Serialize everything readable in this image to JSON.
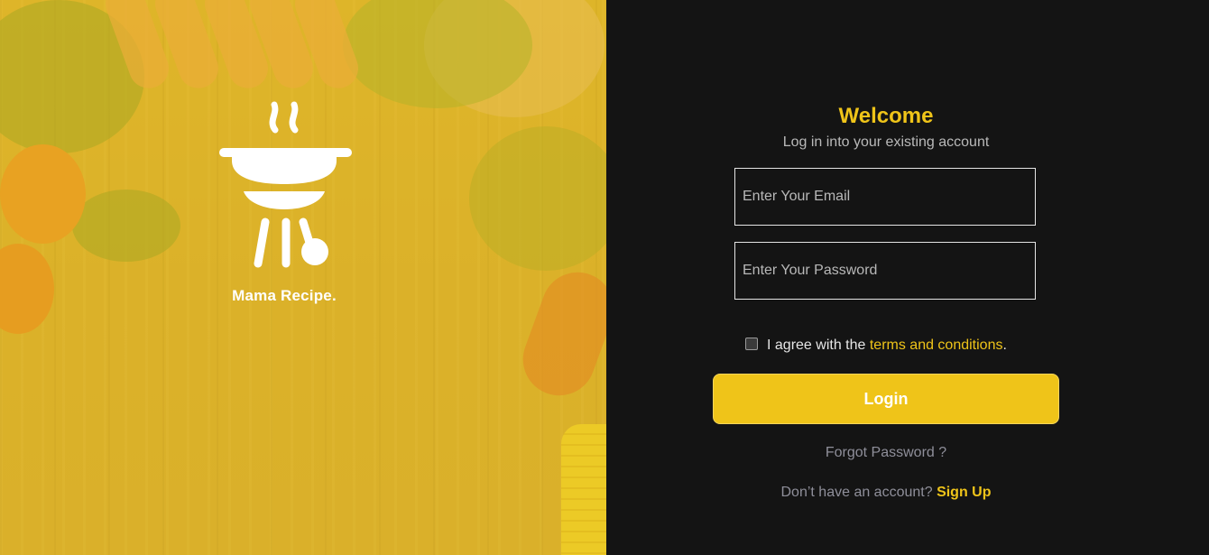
{
  "brand": {
    "name": "Mama Recipe."
  },
  "login": {
    "title": "Welcome",
    "subtitle": "Log in into your existing account",
    "email_placeholder": "Enter Your Email",
    "password_placeholder": "Enter Your Password",
    "agree_prefix": "I agree with the ",
    "agree_link": "terms and conditions",
    "agree_suffix": ".",
    "submit_label": "Login",
    "forgot_label": "Forgot Password ?",
    "signup_prompt": "Don’t have an account? ",
    "signup_link": "Sign Up"
  },
  "icons": {
    "logo": "grill-icon",
    "checkbox": "checkbox-unchecked"
  },
  "colors": {
    "accent": "#efc419",
    "background": "#141414",
    "panel_left": "#d8ad2a"
  }
}
